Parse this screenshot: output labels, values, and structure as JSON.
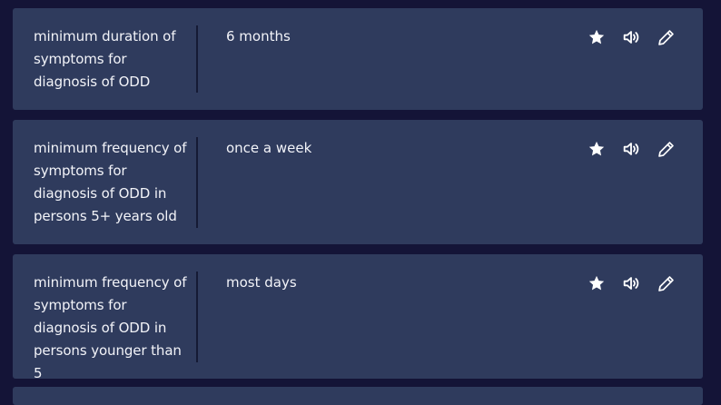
{
  "cards": [
    {
      "term": "minimum duration of symptoms for diagnosis of ODD",
      "definition": "6 months"
    },
    {
      "term": "minimum frequency of symptoms for diagnosis of ODD in persons 5+ years old",
      "definition": "once a week"
    },
    {
      "term": "minimum frequency of symptoms for diagnosis of ODD in persons younger than 5",
      "definition": "most days"
    }
  ],
  "icons": {
    "star": "star-icon",
    "audio": "speaker-icon",
    "edit": "pencil-icon"
  },
  "colors": {
    "background": "#141437",
    "card": "#2f3b5d",
    "divider": "#151a35",
    "text": "#f2f3f8"
  }
}
